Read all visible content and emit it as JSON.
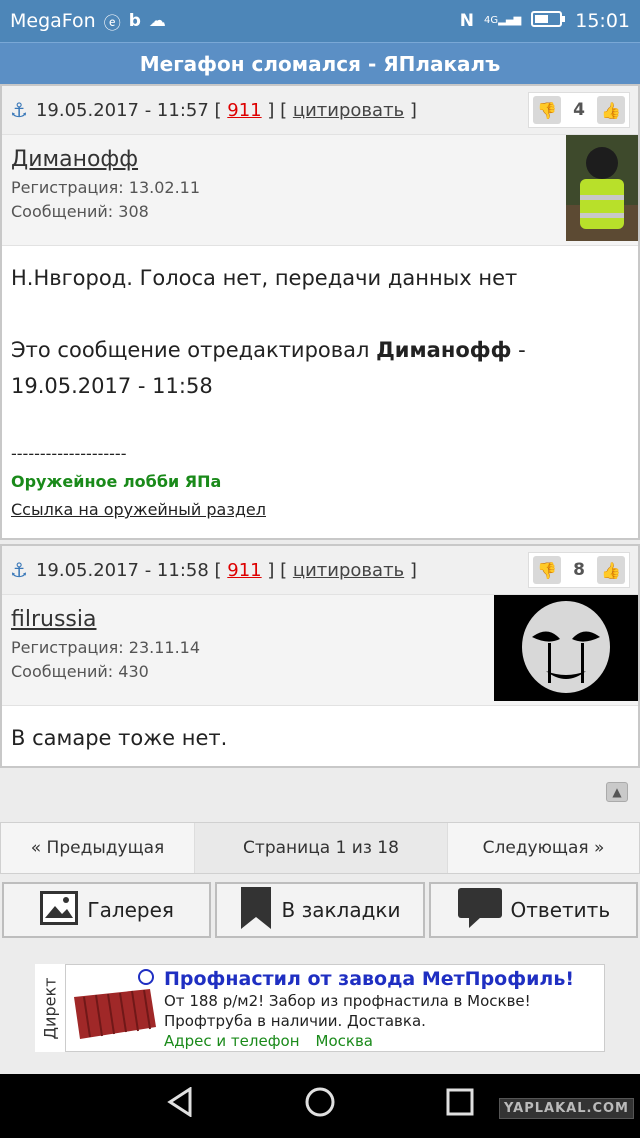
{
  "status_bar": {
    "carrier": "MegaFon",
    "time": "15:01",
    "left_icons": [
      "e-circle-icon",
      "b-logo-icon",
      "cloud-icon"
    ],
    "right_icons": [
      "nfc-icon",
      "4g-signal-icon",
      "battery-icon"
    ],
    "network_label": "4G"
  },
  "page": {
    "title": "Мегафон сломался - ЯПлакалъ"
  },
  "posts": [
    {
      "date": "19.05.2017 - 11:57",
      "post_number": "911",
      "quote_label": "цитировать",
      "rating": "4",
      "author": "Диманофф",
      "registration": "Регистрация: 13.02.11",
      "messages": "Сообщений: 308",
      "body_text": "Н.Нвгород. Голоса нет, передачи данных нет",
      "edit_prefix": "Это сообщение отредактировал ",
      "edit_author": "Диманофф",
      "edit_suffix": " - 19.05.2017 - 11:58",
      "sig_separator": "--------------------",
      "sig_title": "Оружейное лобби ЯПа",
      "sig_link": "Ссылка на оружейный раздел"
    },
    {
      "date": "19.05.2017 - 11:58",
      "post_number": "911",
      "quote_label": "цитировать",
      "rating": "8",
      "author": "filrussia",
      "registration": "Регистрация: 23.11.14",
      "messages": "Сообщений: 430",
      "body_text": "В самаре тоже нет."
    }
  ],
  "pager": {
    "prev": "« Предыдущая",
    "current": "Страница 1 из 18",
    "next": "Следующая »"
  },
  "actions": {
    "gallery": "Галерея",
    "bookmarks": "В закладки",
    "reply": "Ответить"
  },
  "ad": {
    "label": "Директ",
    "title": "Профнастил от завода МетПрофиль!",
    "line1": "От 188 р/м2! Забор из профнастила в Москве!",
    "line2": "Профтруба в наличии. Доставка.",
    "link1": "Адрес и телефон",
    "link2": "Москва"
  },
  "watermark": "YAPLAKAL.COM",
  "colors": {
    "header_blue": "#5b8fc5",
    "statusbar_blue": "#4d86b8",
    "post_number_red": "#d00000",
    "sig_green": "#1a8a1a",
    "ad_title_blue": "#1f2fc2"
  }
}
